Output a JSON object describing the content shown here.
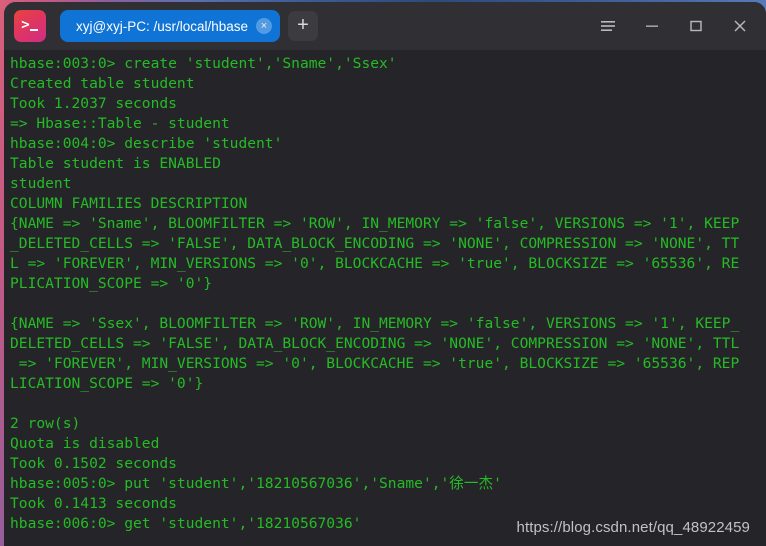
{
  "window": {
    "app_icon": "terminal-prompt-icon",
    "controls": {
      "menu": "hamburger-menu",
      "minimize": "minimize",
      "maximize": "maximize",
      "close": "close"
    }
  },
  "tabs": [
    {
      "label": "xyj@xyj-PC: /usr/local/hbase",
      "close": "×",
      "active": true
    }
  ],
  "newtab": {
    "label": "+"
  },
  "terminal": {
    "prompt_color": "#25bb25",
    "background": "#252529",
    "lines": [
      "hbase:003:0> create 'student','Sname','Ssex'",
      "Created table student",
      "Took 1.2037 seconds",
      "=> Hbase::Table - student",
      "hbase:004:0> describe 'student'",
      "Table student is ENABLED",
      "student",
      "COLUMN FAMILIES DESCRIPTION",
      "{NAME => 'Sname', BLOOMFILTER => 'ROW', IN_MEMORY => 'false', VERSIONS => '1', KEEP",
      "_DELETED_CELLS => 'FALSE', DATA_BLOCK_ENCODING => 'NONE', COMPRESSION => 'NONE', TT",
      "L => 'FOREVER', MIN_VERSIONS => '0', BLOCKCACHE => 'true', BLOCKSIZE => '65536', RE",
      "PLICATION_SCOPE => '0'}",
      "",
      "{NAME => 'Ssex', BLOOMFILTER => 'ROW', IN_MEMORY => 'false', VERSIONS => '1', KEEP_",
      "DELETED_CELLS => 'FALSE', DATA_BLOCK_ENCODING => 'NONE', COMPRESSION => 'NONE', TTL",
      " => 'FOREVER', MIN_VERSIONS => '0', BLOCKCACHE => 'true', BLOCKSIZE => '65536', REP",
      "LICATION_SCOPE => '0'}",
      "",
      "2 row(s)",
      "Quota is disabled",
      "Took 0.1502 seconds",
      "hbase:005:0> put 'student','18210567036','Sname','徐一杰'",
      "Took 0.1413 seconds",
      "hbase:006:0> get 'student','18210567036'"
    ]
  },
  "watermark": {
    "text": "https://blog.csdn.net/qq_48922459"
  }
}
